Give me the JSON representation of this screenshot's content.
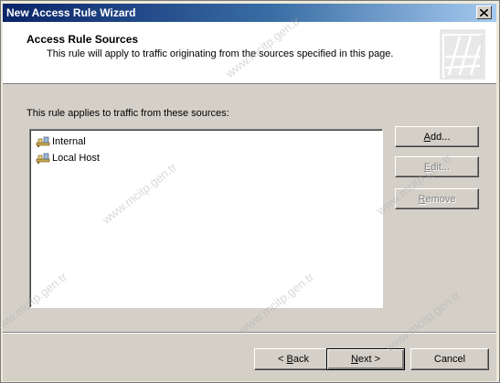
{
  "window": {
    "title": "New Access Rule Wizard",
    "close_icon": "close-icon"
  },
  "header": {
    "title": "Access Rule Sources",
    "subtitle": "This rule will apply to traffic originating from the sources specified in this page."
  },
  "body": {
    "label": "This rule applies to traffic from these sources:",
    "sources": [
      {
        "label": "Internal",
        "icon": "network-icon"
      },
      {
        "label": "Local Host",
        "icon": "network-icon"
      }
    ]
  },
  "buttons": {
    "add": {
      "pre": "",
      "u": "A",
      "post": "dd..."
    },
    "edit": {
      "pre": "",
      "u": "E",
      "post": "dit..."
    },
    "remove": {
      "pre": "",
      "u": "R",
      "post": "emove"
    },
    "back": {
      "pre": "< ",
      "u": "B",
      "post": "ack"
    },
    "next": {
      "pre": "",
      "u": "N",
      "post": "ext >"
    },
    "cancel": "Cancel"
  },
  "watermark": "www.mcitp.gen.tr",
  "colors": {
    "dialog_bg": "#d4d0c8",
    "title_gradient_start": "#0a246a",
    "title_gradient_end": "#a6caf0"
  }
}
